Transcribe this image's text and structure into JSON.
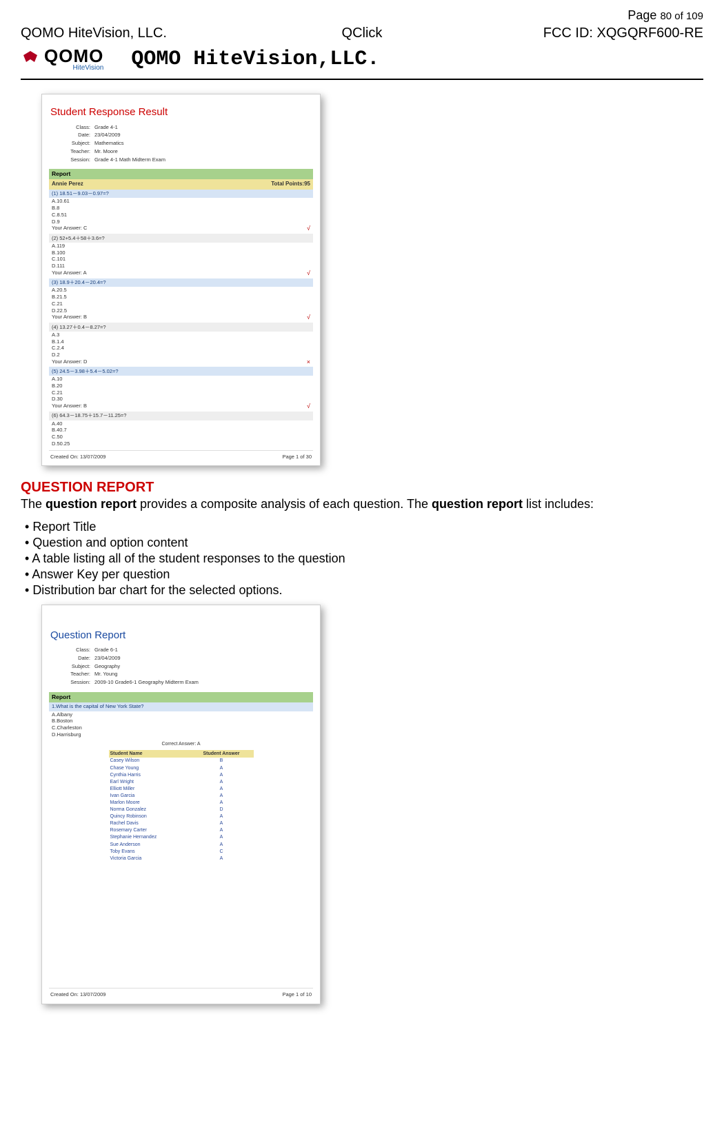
{
  "header": {
    "page_label_prefix": "Page ",
    "page_current": "80",
    "page_of": " of 109",
    "company": "QOMO HiteVision, LLC.",
    "product": "QClick",
    "fcc": "FCC ID: XQGQRF600-RE",
    "logo_main": "QOMO",
    "logo_sub": "HiteVision",
    "brand_title": "QOMO HiteVision,LLC."
  },
  "shot1": {
    "title": "Student Response Result",
    "meta": {
      "class_label": "Class:",
      "class_val": "Grade 4-1",
      "date_label": "Date:",
      "date_val": "23/04/2009",
      "subject_label": "Subject:",
      "subject_val": "Mathematics",
      "teacher_label": "Teacher:",
      "teacher_val": "Mr. Moore",
      "session_label": "Session:",
      "session_val": "Grade 4-1 Math Midterm Exam"
    },
    "report_label": "Report",
    "student_name": "Annie Perez",
    "total_points": "Total Points:95",
    "questions": [
      {
        "q": "(1) 18.51－9.03－0.97=?",
        "opts": [
          "A.10.61",
          "B.8",
          "C.8.51",
          "D.9"
        ],
        "ans_label": "Your Answer:   C",
        "mark": "√"
      },
      {
        "q": "(2) 52+5.4＋58＋3.6=?",
        "opts": [
          "A.119",
          "B.100",
          "C.101",
          "D.111"
        ],
        "ans_label": "Your Answer:   A",
        "mark": "√"
      },
      {
        "q": "(3) 18.9＋20.4－20.4=?",
        "opts": [
          "A.20.5",
          "B.21.5",
          "C.21",
          "D.22.5"
        ],
        "ans_label": "Your Answer:   B",
        "mark": "√"
      },
      {
        "q": "(4) 13.27＋0.4－8.27=?",
        "opts": [
          "A.3",
          "B.1.4",
          "C.2.4",
          "D.2"
        ],
        "ans_label": "Your Answer:   D",
        "mark": "×"
      },
      {
        "q": "(5) 24.5－3.98＋5.4－5.02=?",
        "opts": [
          "A.10",
          "B.20",
          "C.21",
          "D.30"
        ],
        "ans_label": "Your Answer:   B",
        "mark": "√"
      },
      {
        "q": "(6) 64.3－18.75＋15.7－11.25=?",
        "opts": [
          "A.40",
          "B.40.7",
          "C.50",
          "D.50.25"
        ],
        "ans_label": "",
        "mark": ""
      }
    ],
    "created": "Created On: 13/07/2009",
    "page": "Page 1 of 30"
  },
  "section": {
    "title": "QUESTION REPORT",
    "intro_pre": "The ",
    "intro_b1": "question report",
    "intro_mid": " provides a composite analysis of each question. The ",
    "intro_b2": "question report",
    "intro_post": " list includes:",
    "bullets": [
      "Report Title",
      "Question and option content",
      "A table listing all of the student responses to the question",
      "Answer Key per question",
      "Distribution bar chart for the selected options."
    ]
  },
  "shot2": {
    "title": "Question Report",
    "meta": {
      "class_label": "Class:",
      "class_val": "Grade 6-1",
      "date_label": "Date:",
      "date_val": "23/04/2009",
      "subject_label": "Subject:",
      "subject_val": "Geography",
      "teacher_label": "Teacher:",
      "teacher_val": "Mr. Young",
      "session_label": "Session:",
      "session_val": "2009-10 Grade6-1 Geography Midterm Exam"
    },
    "report_label": "Report",
    "q1": "1.What is the capital of New York State?",
    "opts": [
      "A.Albany",
      "B.Boston",
      "C.Charleston",
      "D.Harrisburg"
    ],
    "correct_label": "Correct Answer: A",
    "table_headers": [
      "Student Name",
      "Student Answer"
    ],
    "students": [
      [
        "Casey Wilson",
        "B"
      ],
      [
        "Chase Young",
        "A"
      ],
      [
        "Cynthia Harris",
        "A"
      ],
      [
        "Earl Wright",
        "A"
      ],
      [
        "Elliott Miller",
        "A"
      ],
      [
        "Ivan Garcia",
        "A"
      ],
      [
        "Marlon Moore",
        "A"
      ],
      [
        "Norma Gonzalez",
        "D"
      ],
      [
        "Quincy Robinson",
        "A"
      ],
      [
        "Rachel Davis",
        "A"
      ],
      [
        "Rosemary Carter",
        "A"
      ],
      [
        "Stephanie Hernandez",
        "A"
      ],
      [
        "Sue Anderson",
        "A"
      ],
      [
        "Toby Evans",
        "C"
      ],
      [
        "Victoria Garcia",
        "A"
      ]
    ],
    "created": "Created On: 13/07/2009",
    "page": "Page 1 of 10"
  }
}
